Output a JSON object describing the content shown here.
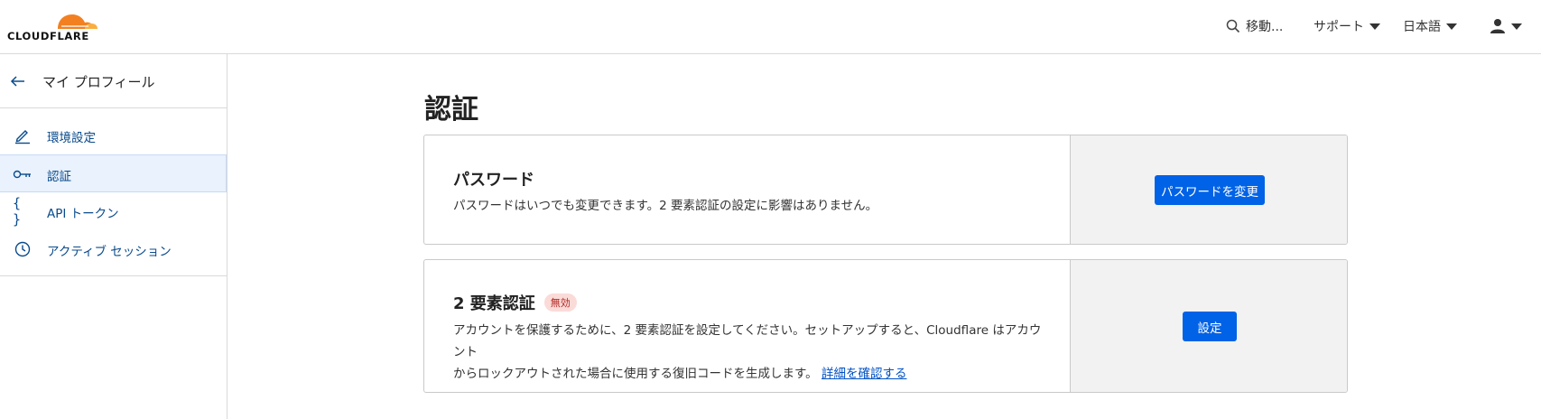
{
  "header": {
    "logo_text": "CLOUDFLARE",
    "search_label": "移動...",
    "support_label": "サポート",
    "language_label": "日本語"
  },
  "sidebar": {
    "back_label": "マイ プロフィール",
    "items": [
      {
        "label": "環境設定",
        "icon": "pencil-icon",
        "active": false
      },
      {
        "label": "認証",
        "icon": "key-icon",
        "active": true
      },
      {
        "label": "API トークン",
        "icon": "braces-icon",
        "active": false
      },
      {
        "label": "アクティブ セッション",
        "icon": "clock-icon",
        "active": false
      }
    ]
  },
  "main": {
    "title": "認証",
    "password_card": {
      "title": "パスワード",
      "description": "パスワードはいつでも変更できます。2 要素認証の設定に影響はありません。",
      "button": "パスワードを変更"
    },
    "twofa_card": {
      "title": "2 要素認証",
      "badge": "無効",
      "description_line1": "アカウントを保護するために、2 要素認証を設定してください。セットアップすると、Cloudflare はアカウント",
      "description_line2": "からロックアウトされた場合に使用する復旧コードを生成します。",
      "link": "詳細を確認する",
      "button": "設定"
    }
  },
  "colors": {
    "accent": "#0062e6",
    "nav_text": "#0a4b8c",
    "logo_orange": "#f38020",
    "badge_bg": "#fadbd8",
    "badge_text": "#b4231f"
  }
}
